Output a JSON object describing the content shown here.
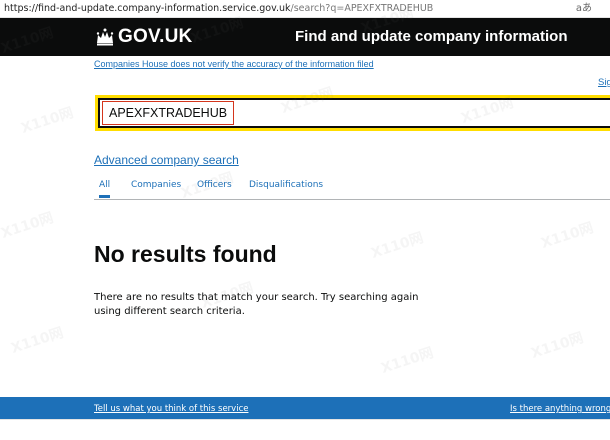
{
  "browser": {
    "url_main": "https://find-and-update.company-information.service.gov.uk",
    "url_rest": "/search?q=APEXFXTRADEHUB",
    "reader_icon": "aあ"
  },
  "header": {
    "logo_text": "GOV.UK",
    "service_name": "Find and update company information"
  },
  "disclaimer_link": "Companies House does not verify the accuracy of the information filed",
  "sign_in_link": "Sig",
  "search": {
    "value": "APEXFXTRADEHUB"
  },
  "advanced_search_link": "Advanced company search",
  "tabs": [
    {
      "label": "All"
    },
    {
      "label": "Companies"
    },
    {
      "label": "Officers"
    },
    {
      "label": "Disqualifications"
    }
  ],
  "results": {
    "heading": "No results found",
    "message": "There are no results that match your search. Try searching again using different search criteria."
  },
  "footer": {
    "left_link": "Tell us what you think of this service",
    "right_link": "Is there anything wrong w"
  },
  "watermark": "X110网",
  "colors": {
    "header_bg": "#0b0c0c",
    "link": "#1d70b8",
    "footer_bg": "#1d70b8",
    "focus": "#ffdd00",
    "search_highlight": "#d4351c"
  }
}
